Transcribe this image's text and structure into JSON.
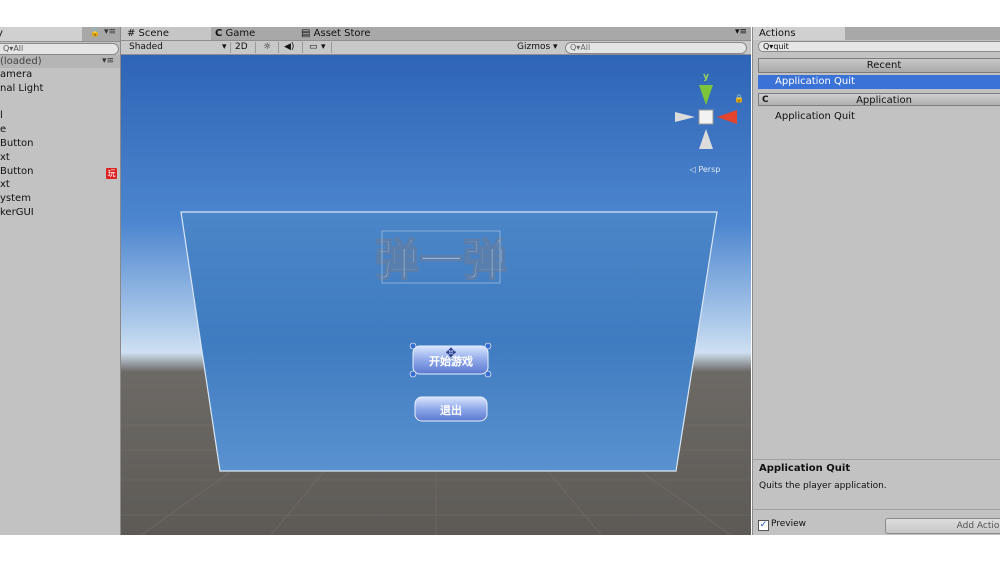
{
  "hierarchy": {
    "tab_label": "y",
    "search_placeholder": "Q▾All",
    "scene_row": "(loaded)",
    "items": [
      "amera",
      "nal Light",
      "",
      "l",
      "e",
      "Button",
      "xt",
      "Button",
      "xt",
      "ystem",
      "kerGUI"
    ],
    "badge": "玩"
  },
  "scene": {
    "tabs": [
      "# Scene",
      "Game",
      "Asset Store"
    ],
    "toolbar": {
      "shading": "Shaded",
      "mode_2d": "2D",
      "gizmos": "Gizmos",
      "search_placeholder": "Q▾All"
    },
    "gizmo_labels": {
      "y": "y",
      "persp": "◁ Persp"
    },
    "game_title": "弹一弹",
    "start_button": "开始游戏",
    "exit_button": "退出"
  },
  "actions": {
    "tab_label": "Actions",
    "search_value": "Q▾quit",
    "recent_header": "Recent",
    "selected_item": "Application Quit",
    "category_header": "Application",
    "category_icon": "C",
    "category_item": "Application Quit",
    "description_title": "Application Quit",
    "description_text": "Quits the player application.",
    "preview_label": "Preview",
    "add_button": "Add Action To S"
  }
}
